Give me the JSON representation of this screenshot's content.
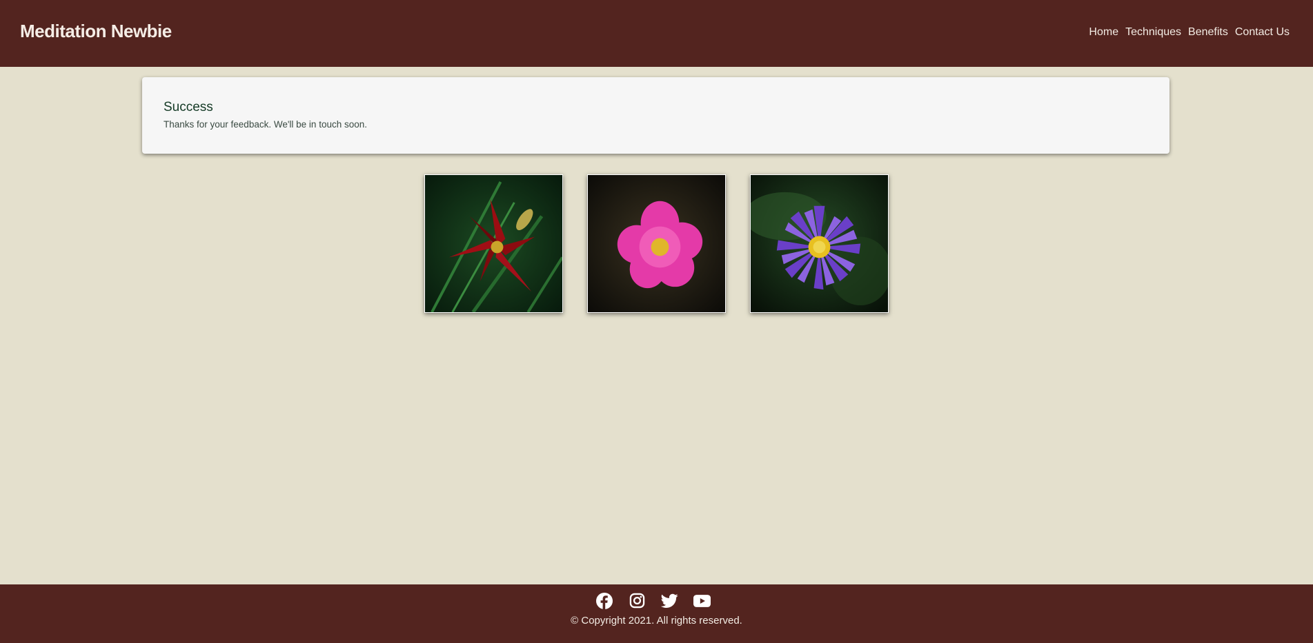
{
  "header": {
    "brand": "Meditation Newbie",
    "nav": [
      "Home",
      "Techniques",
      "Benefits",
      "Contact Us"
    ]
  },
  "message": {
    "title": "Success",
    "text": "Thanks for your feedback. We'll be in touch soon."
  },
  "gallery": {
    "items": [
      "red-lily-photo",
      "pink-flower-photo",
      "purple-lotus-photo"
    ]
  },
  "footer": {
    "socials": [
      "facebook-icon",
      "instagram-icon",
      "twitter-icon",
      "youtube-icon"
    ],
    "copyright": "© Copyright 2021. All rights reserved."
  },
  "colors": {
    "header_bg": "#53241f",
    "page_bg": "#e4e0cd",
    "card_bg": "#f6f6f6",
    "title_color": "#143a25"
  }
}
